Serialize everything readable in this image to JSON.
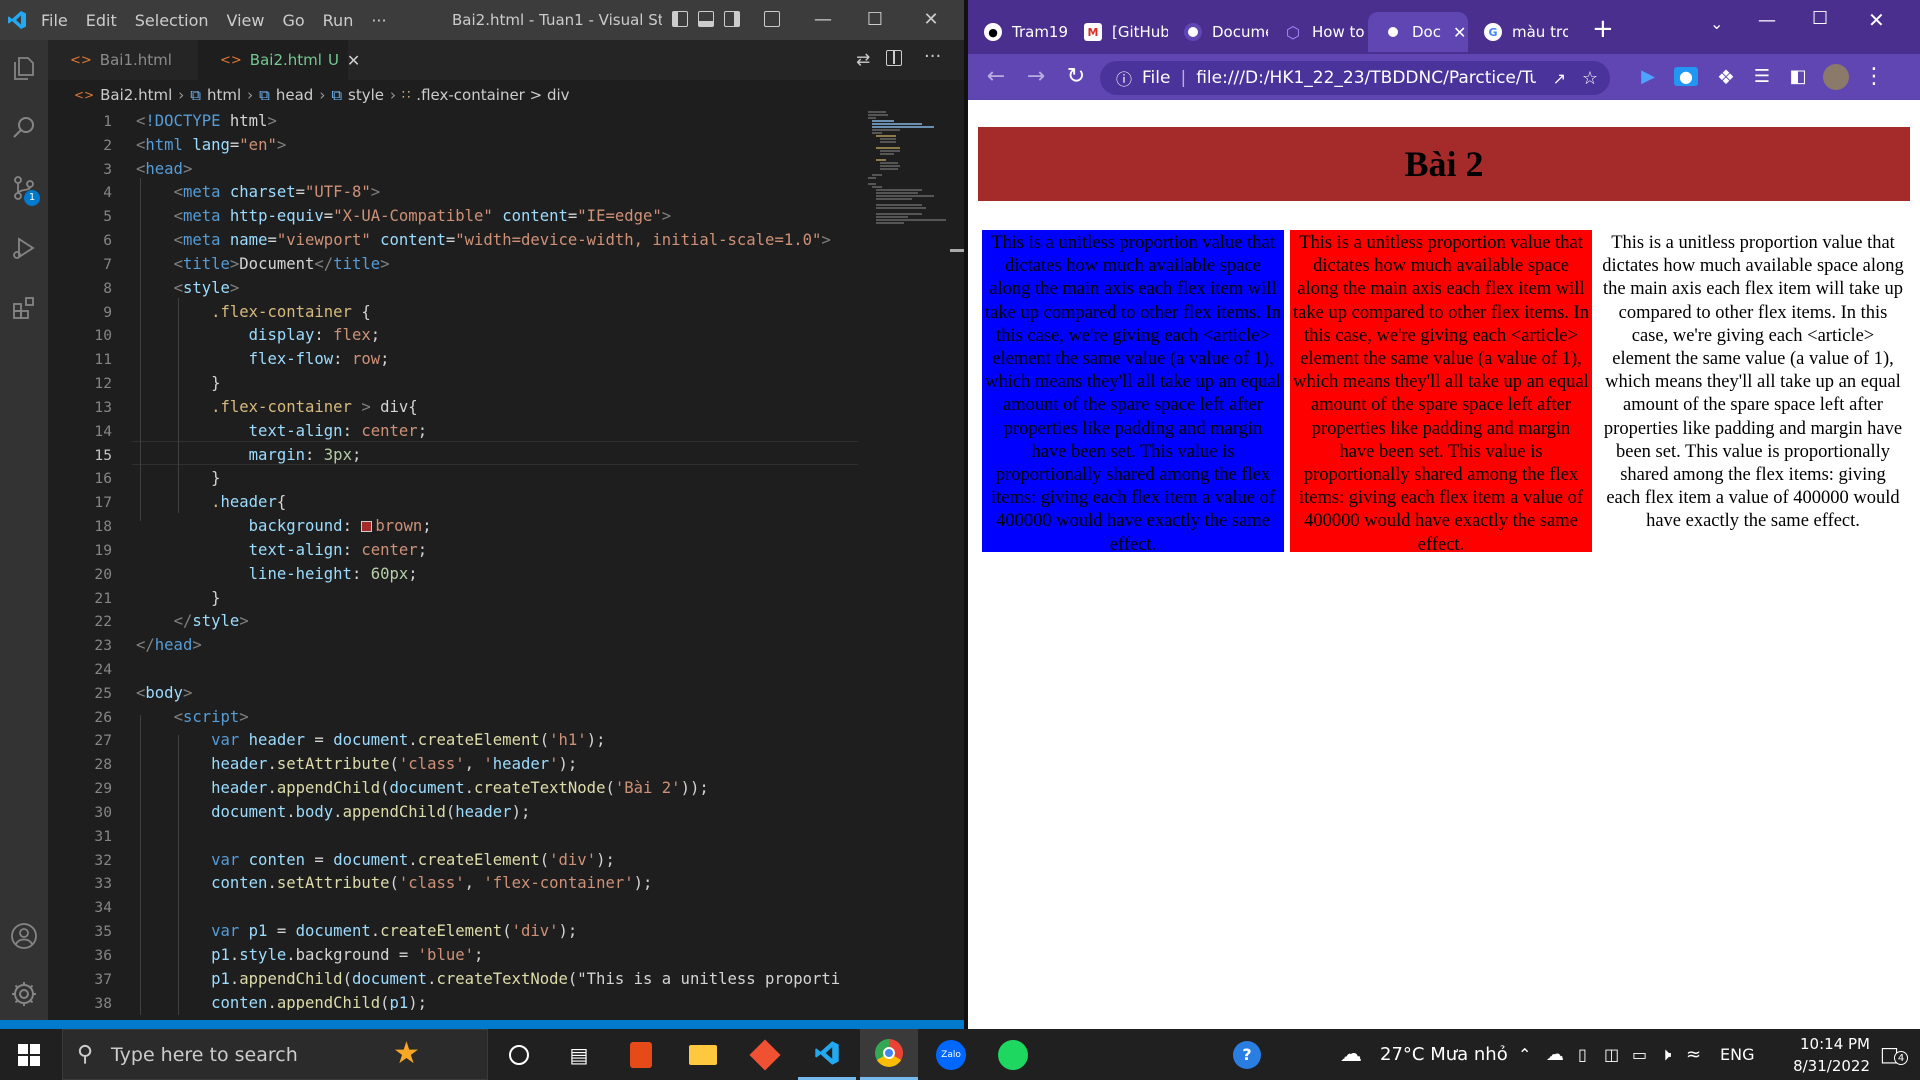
{
  "vscode": {
    "menu": [
      "File",
      "Edit",
      "Selection",
      "View",
      "Go",
      "Run",
      "···"
    ],
    "window_title": "Bai2.html - Tuan1 - Visual Stu...",
    "tabs": [
      {
        "label": "Bai1.html",
        "active": false
      },
      {
        "label": "Bai2.html",
        "active": true,
        "marker": "U"
      }
    ],
    "breadcrumb": [
      "Bai2.html",
      "html",
      "head",
      "style",
      ".flex-container > div"
    ],
    "source_control_badge": "1",
    "current_line": 15,
    "code_lines": [
      "<!DOCTYPE html>",
      "<html lang=\"en\">",
      "<head>",
      "    <meta charset=\"UTF-8\">",
      "    <meta http-equiv=\"X-UA-Compatible\" content=\"IE=edge\">",
      "    <meta name=\"viewport\" content=\"width=device-width, initial-scale=1.0\">",
      "    <title>Document</title>",
      "    <style>",
      "        .flex-container {",
      "            display: flex;",
      "            flex-flow: row;",
      "        }",
      "        .flex-container > div{",
      "            text-align: center;",
      "            margin: 3px;",
      "        }",
      "        .header{",
      "            background: ■brown;",
      "            text-align: center;",
      "            line-height: 60px;",
      "        }",
      "    </style>",
      "</head>",
      "",
      "<body>",
      "    <script>",
      "        var header = document.createElement('h1');",
      "        header.setAttribute('class', 'header');",
      "        header.appendChild(document.createTextNode('Bài 2'));",
      "        document.body.appendChild(header);",
      "",
      "        var conten = document.createElement('div');",
      "        conten.setAttribute('class', 'flex-container');",
      "",
      "        var p1 = document.createElement('div');",
      "        p1.style.background = 'blue';",
      "        p1.appendChild(document.createTextNode(\"This is a unitless proporti",
      "        conten.appendChild(p1);"
    ]
  },
  "chrome": {
    "tabs": [
      {
        "label": "Tram19",
        "icon": "github-icon"
      },
      {
        "label": "[GitHub",
        "icon": "gmail-icon"
      },
      {
        "label": "Docume",
        "icon": "chrome-icon"
      },
      {
        "label": "How to",
        "icon": "hexagon-icon"
      },
      {
        "label": "Doc",
        "icon": "chrome-icon",
        "active": true
      },
      {
        "label": "màu trơ",
        "icon": "google-icon"
      }
    ],
    "url_prefix": "File",
    "url": "file:///D:/HK1_22_23/TBDDNC/Parctice/Tua...",
    "page": {
      "heading": "Bài 2",
      "boxes": [
        {
          "bg": "#0000ff",
          "text": "This is a unitless proportion value that dictates how much available space along the main axis each flex item will take up compared to other flex items. In this case, we're giving each <article> element the same value (a value of 1), which means they'll all take up an equal amount of the spare space left after properties like padding and margin have been set. This value is proportionally shared among the flex items: giving each flex item a value of 400000 would have exactly the same effect."
        },
        {
          "bg": "#ff0000",
          "text": "This is a unitless proportion value that dictates how much available space along the main axis each flex item will take up compared to other flex items. In this case, we're giving each <article> element the same value (a value of 1), which means they'll all take up an equal amount of the spare space left after properties like padding and margin have been set. This value is proportionally shared among the flex items: giving each flex item a value of 400000 would have exactly the same effect."
        },
        {
          "bg": "#ffffff",
          "text": "This is a unitless proportion value that dictates how much available space along the main axis each flex item will take up compared to other flex items. In this case, we're giving each <article> element the same value (a value of 1), which means they'll all take up an equal amount of the spare space left after properties like padding and margin have been set. This value is proportionally shared among the flex items: giving each flex item a value of 400000 would have exactly the same effect."
        }
      ]
    }
  },
  "taskbar": {
    "search_placeholder": "Type here to search",
    "weather": "27°C  Mưa nhỏ",
    "lang": "ENG",
    "time": "10:14 PM",
    "date": "8/31/2022",
    "notif_count": "4",
    "apps": [
      "cortana",
      "task-view",
      "office",
      "file-explorer",
      "git",
      "vscode",
      "chrome",
      "zalo",
      "spotify"
    ],
    "zalo_label": "Zalo"
  },
  "colors": {
    "vs_bg": "#1e1e1e",
    "chrome_frame": "#4a2f8e",
    "heading_bg": "#a52a2a",
    "accent": "#007acc"
  }
}
